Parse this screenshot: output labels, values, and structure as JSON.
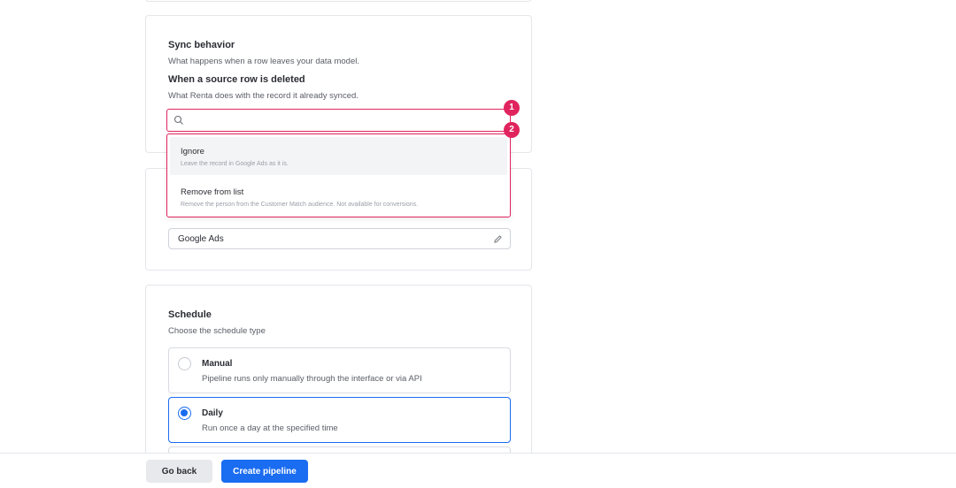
{
  "sync": {
    "title": "Sync behavior",
    "subtitle": "What happens when a row leaves your data model.",
    "deleted_title": "When a source row is deleted",
    "deleted_subtitle": "What Renta does with the record it already synced.",
    "search_value": "",
    "search_placeholder": "",
    "options": [
      {
        "label": "Ignore",
        "description": "Leave the record in Google Ads as it is.",
        "highlighted": true
      },
      {
        "label": "Remove from list",
        "description": "Remove the person from the Customer Match audience. Not available for conversions.",
        "highlighted": false
      }
    ]
  },
  "annotations": [
    "1",
    "2"
  ],
  "destination": {
    "value": "Google Ads",
    "edit_icon": "pencil-icon"
  },
  "schedule": {
    "title": "Schedule",
    "subtitle": "Choose the schedule type",
    "options": [
      {
        "label": "Manual",
        "description": "Pipeline runs only manually through the interface or via API",
        "selected": false
      },
      {
        "label": "Daily",
        "description": "Run once a day at the specified time",
        "selected": true
      }
    ]
  },
  "footer": {
    "back_label": "Go back",
    "create_label": "Create pipeline"
  },
  "colors": {
    "accent": "#1a6cf0",
    "annotation": "#e0245e"
  }
}
